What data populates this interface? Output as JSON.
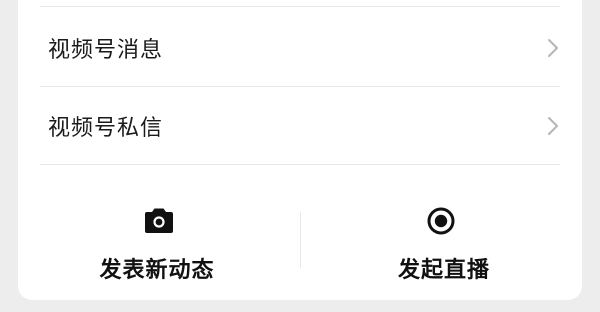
{
  "menu": {
    "items": [
      {
        "label": "视频号消息",
        "icon": "chevron-right-icon"
      },
      {
        "label": "视频号私信",
        "icon": "chevron-right-icon"
      }
    ]
  },
  "actions": {
    "post": {
      "label": "发表新动态",
      "icon": "camera-icon"
    },
    "live": {
      "label": "发起直播",
      "icon": "record-icon"
    }
  },
  "colors": {
    "background": "#ededed",
    "card": "#ffffff",
    "text": "#1a1a1a",
    "divider": "#e6e6e6",
    "chevron": "#b5b5b5"
  }
}
